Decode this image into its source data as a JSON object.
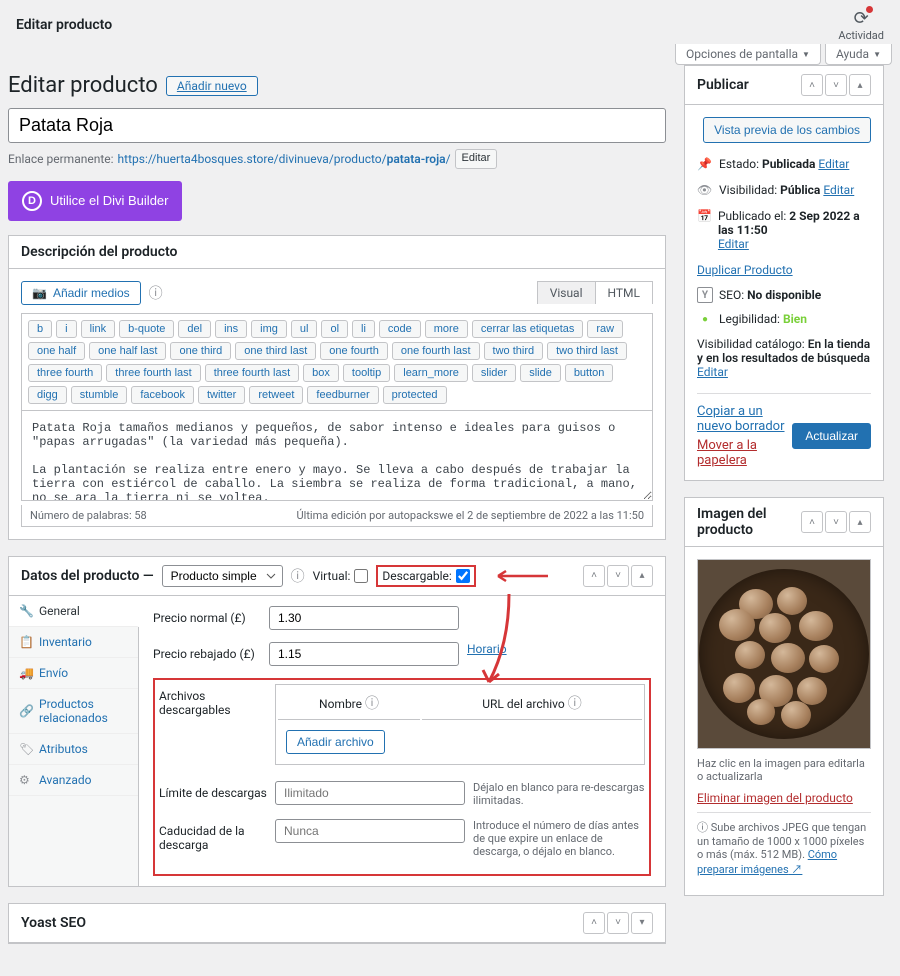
{
  "topbar": {
    "title": "Editar producto",
    "activity": "Actividad"
  },
  "screen_options": {
    "screen": "Opciones de pantalla",
    "help": "Ayuda"
  },
  "heading": {
    "title": "Editar producto",
    "add_new": "Añadir nuevo"
  },
  "title_input": "Patata Roja",
  "permalink": {
    "label": "Enlace permanente:",
    "base": "https://huerta4bosques.store/divinueva/producto/",
    "slug": "patata-roja",
    "slash": "/",
    "edit": "Editar"
  },
  "divi": "Utilice el Divi Builder",
  "description": {
    "title": "Descripción del producto",
    "add_media": "Añadir medios",
    "tabs": {
      "visual": "Visual",
      "html": "HTML"
    },
    "quicktags": [
      "b",
      "i",
      "link",
      "b-quote",
      "del",
      "ins",
      "img",
      "ul",
      "ol",
      "li",
      "code",
      "more",
      "cerrar las etiquetas",
      "raw",
      "one half",
      "one half last",
      "one third",
      "one third last",
      "one fourth",
      "one fourth last",
      "two third",
      "two third last",
      "three fourth",
      "three fourth last",
      "three fourth last",
      "box",
      "tooltip",
      "learn_more",
      "slider",
      "slide",
      "button",
      "digg",
      "stumble",
      "facebook",
      "twitter",
      "retweet",
      "feedburner",
      "protected"
    ],
    "content": "Patata Roja tamaños medianos y pequeños, de sabor intenso e ideales para guisos o \"papas arrugadas\" (la variedad más pequeña).\n\nLa plantación se realiza entre enero y mayo. Se lleva a cabo después de trabajar la tierra con estiércol de caballo. La siembra se realiza de forma tradicional, a mano, no se ara la tierra ni se voltea.",
    "wordcount": "Número de palabras: 58",
    "last_edit": "Última edición por autopackswe el 2 de septiembre de 2022 a las 11:50"
  },
  "product_data": {
    "title": "Datos del producto —",
    "type": "Producto simple",
    "virtual": "Virtual:",
    "downloadable": "Descargable:",
    "tabs": {
      "general": "General",
      "inventory": "Inventario",
      "shipping": "Envío",
      "linked": "Productos relacionados",
      "attributes": "Atributos",
      "advanced": "Avanzado"
    },
    "regular_price_label": "Precio normal (£)",
    "regular_price": "1.30",
    "sale_price_label": "Precio rebajado (£)",
    "sale_price": "1.15",
    "schedule": "Horario",
    "downloads_label": "Archivos descargables",
    "col_name": "Nombre",
    "col_url": "URL del archivo",
    "add_file": "Añadir archivo",
    "limit_label": "Límite de descargas",
    "limit_placeholder": "Ilimitado",
    "limit_desc": "Déjalo en blanco para re-descargas ilimitadas.",
    "expiry_label": "Caducidad de la descarga",
    "expiry_placeholder": "Nunca",
    "expiry_desc": "Introduce el número de días antes de que expire un enlace de descarga, o déjalo en blanco."
  },
  "yoast": {
    "title": "Yoast SEO"
  },
  "publish": {
    "title": "Publicar",
    "preview": "Vista previa de los cambios",
    "status_label": "Estado:",
    "status_value": "Publicada",
    "visibility_label": "Visibilidad:",
    "visibility_value": "Pública",
    "published_label": "Publicado el:",
    "published_value": "2 Sep 2022 a las 11:50",
    "edit": "Editar",
    "duplicate": "Duplicar Producto",
    "seo_label": "SEO:",
    "seo_value": "No disponible",
    "readability_label": "Legibilidad:",
    "readability_value": "Bien",
    "catalog_label": "Visibilidad catálogo:",
    "catalog_value": "En la tienda y en los resultados de búsqueda",
    "copy_draft": "Copiar a un nuevo borrador",
    "trash": "Mover a la papelera",
    "update": "Actualizar"
  },
  "image_box": {
    "title": "Imagen del producto",
    "caption": "Haz clic en la imagen para editarla o actualizarla",
    "remove": "Eliminar imagen del producto",
    "help": "Sube archivos JPEG que tengan un tamaño de 1000 x 1000 píxeles o más (máx. 512 MB).",
    "help_link": "Cómo preparar imágenes"
  }
}
